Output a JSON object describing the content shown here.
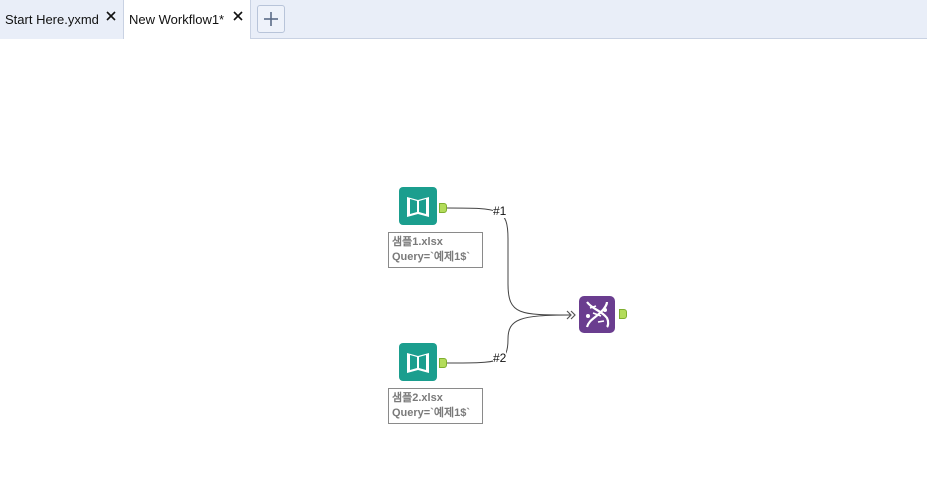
{
  "tabs": [
    {
      "label": "Start Here.yxmd",
      "active": false
    },
    {
      "label": "New Workflow1*",
      "active": true
    }
  ],
  "add_tab_icon": "plus-icon",
  "canvas": {
    "input1": {
      "icon": "book-icon",
      "annotation_line1": "샘플1.xlsx",
      "annotation_line2": "Query=`예제1$`"
    },
    "input2": {
      "icon": "book-icon",
      "annotation_line1": "샘플2.xlsx",
      "annotation_line2": "Query=`예제1$`"
    },
    "connection1_label": "#1",
    "connection2_label": "#2",
    "join_tool": {
      "icon": "dna-icon"
    }
  },
  "colors": {
    "input_tool": "#1b9e8e",
    "join_tool": "#6a3d8f",
    "anchor": "#b3dc5a",
    "tabbar": "#e9eef8"
  }
}
